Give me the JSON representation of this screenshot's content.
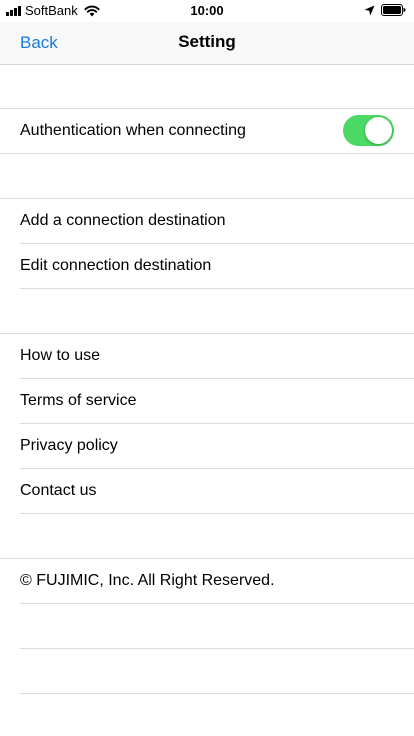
{
  "status_bar": {
    "carrier": "SoftBank",
    "time": "10:00",
    "icons": [
      "signal-icon",
      "wifi-icon",
      "location-icon",
      "battery-icon"
    ]
  },
  "nav": {
    "back_label": "Back",
    "title": "Setting"
  },
  "settings": {
    "auth_label": "Authentication when connecting",
    "auth_enabled": true,
    "add_destination": "Add a connection destination",
    "edit_destination": "Edit connection destination",
    "how_to_use": "How to use",
    "terms": "Terms of service",
    "privacy": "Privacy policy",
    "contact": "Contact us",
    "copyright": "© FUJIMIC, Inc. All Right Reserved."
  },
  "colors": {
    "accent": "#1a7ae3",
    "toggle_on": "#4cd964",
    "separator": "#dcdcdc"
  }
}
